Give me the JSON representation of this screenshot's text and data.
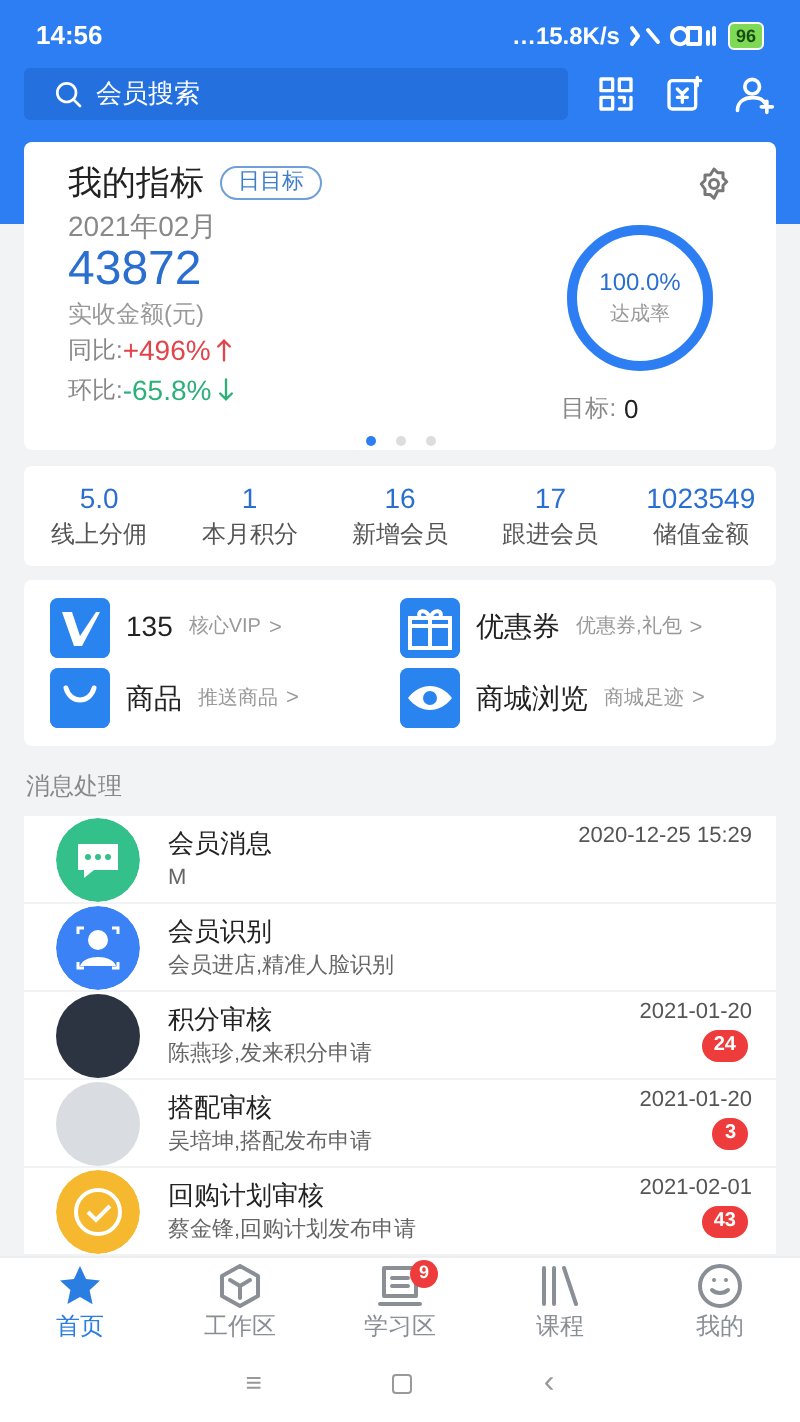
{
  "status_bar": {
    "time": "14:56",
    "speed": "…15.8K/s",
    "battery": "96"
  },
  "search": {
    "placeholder": "会员搜索"
  },
  "indicator_card": {
    "title": "我的指标",
    "tag": "日目标",
    "period": "2021年02月",
    "amount": "43872",
    "amount_label": "实收金额(元)",
    "yoy": {
      "label": "同比:",
      "value": "+496%",
      "rising": true
    },
    "mom": {
      "label": "环比:",
      "value": "-65.8%",
      "rising": false
    },
    "ring": {
      "level": 1.0,
      "value": "100.0%",
      "label": "达成率"
    },
    "target": {
      "label": "目标:",
      "value": "0"
    },
    "pages": [
      {
        "selected": true
      },
      {
        "selected": false
      },
      {
        "selected": false
      }
    ]
  },
  "stats": [
    {
      "value": "5.0",
      "label": "线上分佣"
    },
    {
      "value": "1",
      "label": "本月积分"
    },
    {
      "value": "16",
      "label": "新增会员"
    },
    {
      "value": "17",
      "label": "跟进会员"
    },
    {
      "value": "1023549",
      "label": "储值金额"
    }
  ],
  "shortcuts": [
    {
      "kind": "vip",
      "title": "135",
      "hint": "核心VIP",
      "chevron": ">"
    },
    {
      "kind": "gift",
      "title": "优惠券",
      "hint": "优惠券,礼包",
      "chevron": ">"
    },
    {
      "kind": "bag",
      "title": "商品",
      "hint": "推送商品",
      "chevron": ">"
    },
    {
      "kind": "eye",
      "title": "商城浏览",
      "hint": "商城足迹",
      "chevron": ">"
    }
  ],
  "section_title": "消息处理",
  "messages": [
    {
      "kind": "chat",
      "title": "会员消息",
      "subtitle": "M",
      "time": "2020-12-25 15:29"
    },
    {
      "kind": "face",
      "title": "会员识别",
      "subtitle": "会员进店,精准人脸识别"
    },
    {
      "kind": "photo",
      "title": "积分审核",
      "subtitle": "陈燕珍,发来积分申请",
      "time": "2021-01-20",
      "count": "24"
    },
    {
      "kind": "illustration",
      "title": "搭配审核",
      "subtitle": "吴培坤,搭配发布申请",
      "time": "2021-01-20",
      "count": "3"
    },
    {
      "kind": "check",
      "title": "回购计划审核",
      "subtitle": "蔡金锋,回购计划发布申请",
      "time": "2021-02-01",
      "count": "43"
    }
  ],
  "tabs": [
    {
      "kind": "home",
      "label": "首页",
      "selected": true
    },
    {
      "kind": "work",
      "label": "工作区",
      "selected": false
    },
    {
      "kind": "study",
      "label": "学习区",
      "selected": false,
      "badge": "9"
    },
    {
      "kind": "course",
      "label": "课程",
      "selected": false
    },
    {
      "kind": "me",
      "label": "我的",
      "selected": false
    }
  ],
  "nav_bar": {
    "menu": "≡",
    "back": "‹"
  }
}
